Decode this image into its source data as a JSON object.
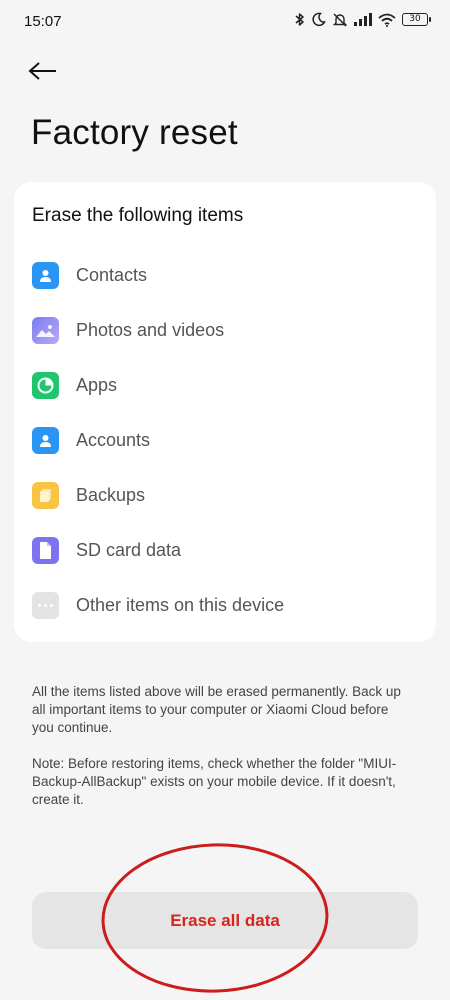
{
  "status_bar": {
    "time": "15:07",
    "battery": "30",
    "icons": [
      "bluetooth-icon",
      "moon-icon",
      "mute-icon",
      "signal-icon",
      "wifi-icon",
      "battery-icon"
    ]
  },
  "header": {
    "back_icon": "arrow-left-icon",
    "title": "Factory reset"
  },
  "card": {
    "title": "Erase the following items",
    "items": [
      {
        "label": "Contacts",
        "icon": "contacts-icon",
        "color": "#2b95f3"
      },
      {
        "label": "Photos and videos",
        "icon": "photos-icon",
        "color": "#7a7ef0"
      },
      {
        "label": "Apps",
        "icon": "apps-icon",
        "color": "#1fc66b"
      },
      {
        "label": "Accounts",
        "icon": "accounts-icon",
        "color": "#2b95f3"
      },
      {
        "label": "Backups",
        "icon": "backups-icon",
        "color": "#f7c543"
      },
      {
        "label": "SD card data",
        "icon": "sd-card-icon",
        "color": "#7d73ef"
      },
      {
        "label": "Other items on this device",
        "icon": "more-icon",
        "color": "#e3e3e3"
      }
    ]
  },
  "notes": {
    "warning": "All the items listed above will be erased permanently. Back up all important items to your computer or Xiaomi Cloud before you continue.",
    "restore": "Note: Before restoring items, check whether the folder \"MIUI-Backup-AllBackup\" exists on your mobile device. If it doesn't, create it."
  },
  "actions": {
    "erase_label": "Erase all data"
  },
  "colors": {
    "danger": "#d9231d",
    "annotation": "#cc1d1d",
    "background": "#f5f5f5"
  }
}
